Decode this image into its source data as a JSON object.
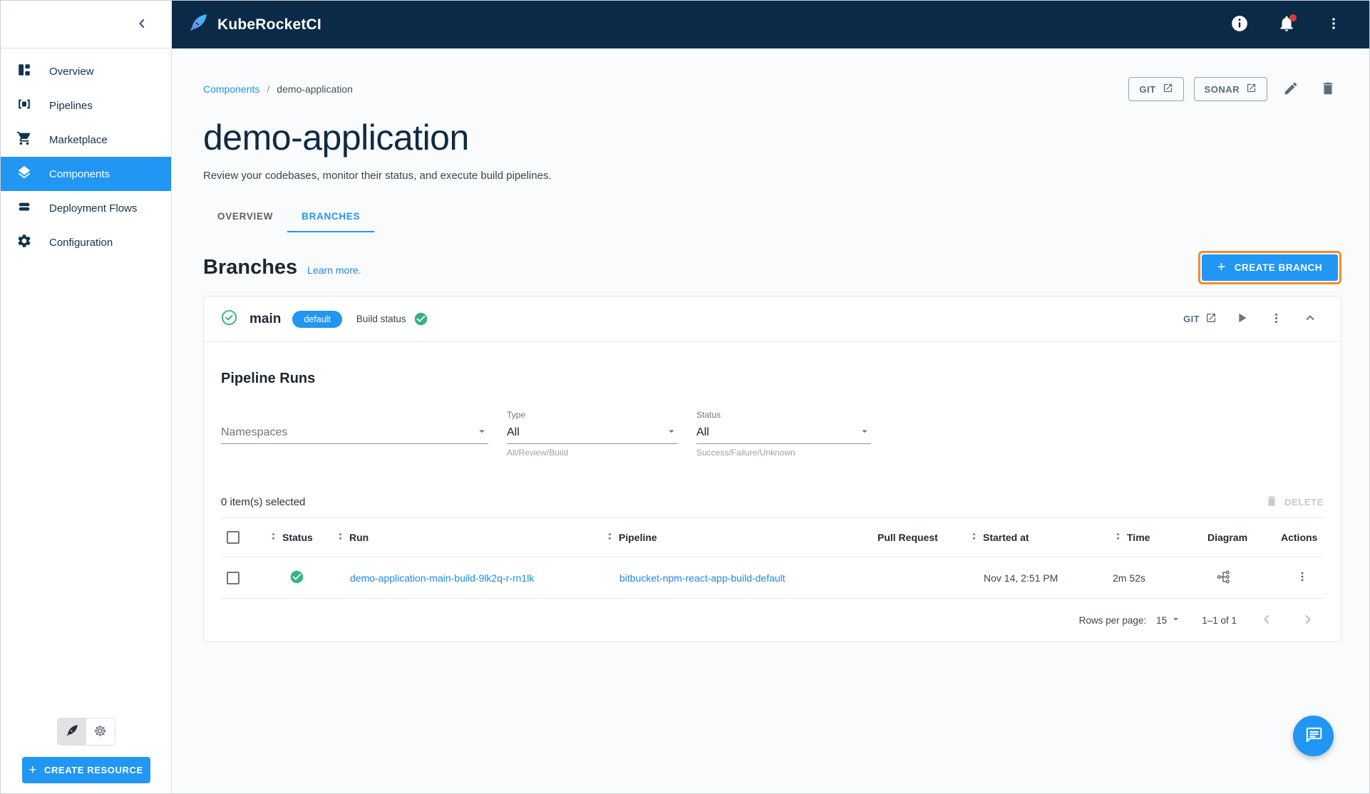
{
  "header": {
    "brand": "KubeRocketCI"
  },
  "sidebar": {
    "items": [
      {
        "label": "Overview"
      },
      {
        "label": "Pipelines"
      },
      {
        "label": "Marketplace"
      },
      {
        "label": "Components"
      },
      {
        "label": "Deployment Flows"
      },
      {
        "label": "Configuration"
      }
    ],
    "create_resource_label": "CREATE RESOURCE"
  },
  "breadcrumb": {
    "section": "Components",
    "separator": "/",
    "current": "demo-application"
  },
  "page": {
    "title": "demo-application",
    "subtitle": "Review your codebases, monitor their status, and execute build pipelines.",
    "git_button": "GIT",
    "sonar_button": "SONAR"
  },
  "tabs": {
    "overview": "OVERVIEW",
    "branches": "BRANCHES"
  },
  "branches_section": {
    "heading": "Branches",
    "learn_more": "Learn more.",
    "create_button": "CREATE BRANCH"
  },
  "branch": {
    "name": "main",
    "chip": "default",
    "build_status_label": "Build status",
    "build_status": "success",
    "git_label": "GIT"
  },
  "pipeline_runs": {
    "heading": "Pipeline Runs",
    "filters": {
      "namespaces_placeholder": "Namespaces",
      "type_label": "Type",
      "type_value": "All",
      "type_helper": "All/Review/Build",
      "status_label": "Status",
      "status_value": "All",
      "status_helper": "Success/Failure/Unknown"
    },
    "selection_text": "0 item(s) selected",
    "delete_label": "DELETE",
    "table": {
      "columns": [
        "Status",
        "Run",
        "Pipeline",
        "Pull Request",
        "Started at",
        "Time",
        "Diagram",
        "Actions"
      ],
      "rows": [
        {
          "status": "success",
          "run": "demo-application-main-build-9lk2q-r-rn1lk",
          "pipeline": "bitbucket-npm-react-app-build-default",
          "pull_request": "",
          "started_at": "Nov 14, 2:51 PM",
          "time": "2m 52s"
        }
      ]
    },
    "pagination": {
      "rows_per_page_label": "Rows per page:",
      "rows_per_page_value": "15",
      "range": "1–1 of 1"
    }
  },
  "colors": {
    "header_bg": "#0b2a47",
    "accent": "#2196f3",
    "success_green": "#36b37e",
    "highlight_orange": "#f28c2e",
    "link_blue": "#1e88e5"
  }
}
